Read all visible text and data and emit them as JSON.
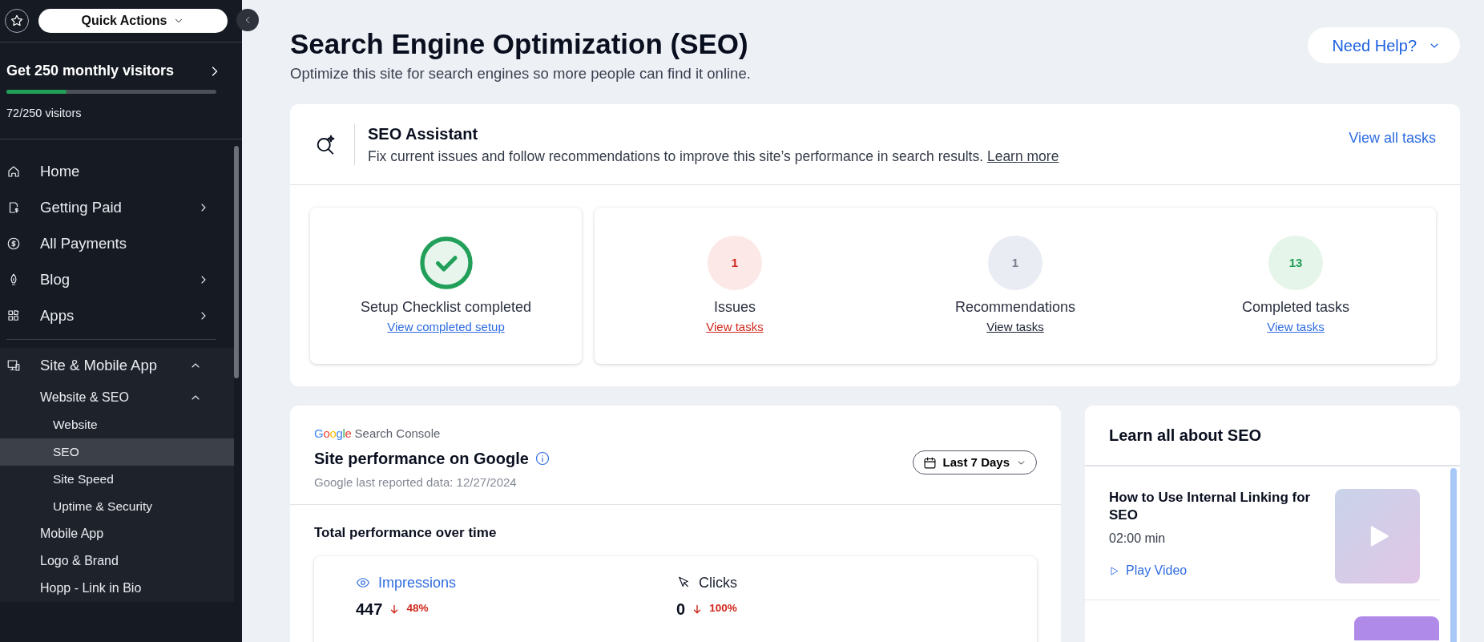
{
  "sidebar": {
    "quick_actions": "Quick Actions",
    "goal": {
      "title": "Get 250 monthly visitors",
      "level": 0.288,
      "reading": "72/250 visitors"
    },
    "items": [
      {
        "label": "Home",
        "selected": false
      },
      {
        "label": "Getting Paid",
        "selected": false,
        "expanded": false
      },
      {
        "label": "All Payments",
        "selected": false
      },
      {
        "label": "Blog",
        "selected": false,
        "expanded": false
      },
      {
        "label": "Apps",
        "selected": false,
        "expanded": false
      },
      {
        "label": "Site & Mobile App",
        "selected": false,
        "expanded": true,
        "children": [
          {
            "label": "Website & SEO",
            "selected": false,
            "expanded": true,
            "children": [
              {
                "label": "Website",
                "selected": false
              },
              {
                "label": "SEO",
                "selected": true
              },
              {
                "label": "Site Speed",
                "selected": false
              },
              {
                "label": "Uptime & Security",
                "selected": false
              }
            ]
          },
          {
            "label": "Mobile App",
            "selected": false
          },
          {
            "label": "Logo & Brand",
            "selected": false
          },
          {
            "label": "Hopp - Link in Bio",
            "selected": false
          }
        ]
      }
    ]
  },
  "header": {
    "title": "Search Engine Optimization (SEO)",
    "subtitle": "Optimize this site for search engines so more people can find it online.",
    "help_button": "Need Help?"
  },
  "seo_assistant": {
    "title": "SEO Assistant",
    "description": "Fix current issues and follow recommendations to improve this site’s performance in search results.",
    "learn_more": "Learn more",
    "view_all": "View all tasks",
    "setup": {
      "label": "Setup Checklist completed",
      "link": "View completed setup"
    },
    "stats": [
      {
        "kind": "issues",
        "count": "1",
        "label": "Issues",
        "link": "View tasks"
      },
      {
        "kind": "recommendations",
        "count": "1",
        "label": "Recommendations",
        "link": "View tasks"
      },
      {
        "kind": "completed",
        "count": "13",
        "label": "Completed tasks",
        "link": "View tasks"
      }
    ]
  },
  "performance": {
    "logo": "Google",
    "logo_suffix": "Search Console",
    "title": "Site performance on Google",
    "reported": "Google last reported data: 12/27/2024",
    "range": "Last 7 Days",
    "section_title": "Total performance over time",
    "metrics": [
      {
        "kind": "impressions",
        "label": "Impressions",
        "selected": true,
        "value": "447",
        "decreased": true,
        "change": "48%"
      },
      {
        "kind": "clicks",
        "label": "Clicks",
        "selected": false,
        "value": "0",
        "decreased": true,
        "change": "100%"
      }
    ]
  },
  "learn": {
    "title": "Learn all about SEO",
    "videos": [
      {
        "title": "How to Use Internal Linking for SEO",
        "duration": "02:00 min",
        "action": "Play Video"
      }
    ]
  }
}
